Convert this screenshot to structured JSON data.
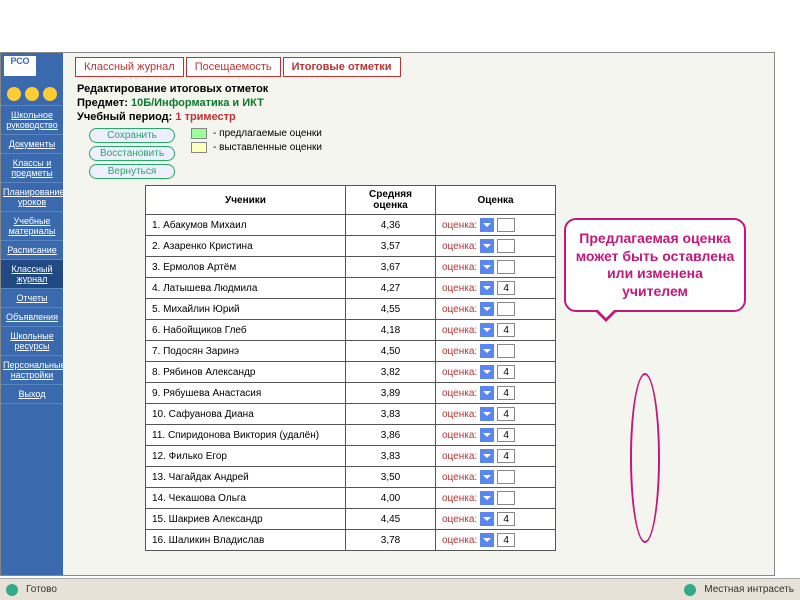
{
  "app": {
    "logo": "РСО"
  },
  "sidebar": {
    "items": [
      {
        "label": "Школьное руководство"
      },
      {
        "label": "Документы"
      },
      {
        "label": "Классы и предметы"
      },
      {
        "label": "Планирование уроков"
      },
      {
        "label": "Учебные материалы"
      },
      {
        "label": "Расписание"
      },
      {
        "label": "Классный журнал",
        "active": true
      },
      {
        "label": "Отчеты"
      },
      {
        "label": "Объявления"
      },
      {
        "label": "Школьные ресурсы"
      },
      {
        "label": "Персональные настройки"
      },
      {
        "label": "Выход"
      }
    ]
  },
  "tabs": [
    {
      "label": "Классный журнал"
    },
    {
      "label": "Посещаемость"
    },
    {
      "label": "Итоговые отметки",
      "active": true
    }
  ],
  "header": {
    "title": "Редактирование итоговых отметок",
    "subject_label": "Предмет:",
    "subject_value": "10Б/Информатика и ИКТ",
    "period_label": "Учебный период:",
    "period_value": "1 триместр"
  },
  "buttons": {
    "save": "Сохранить",
    "restore": "Восстановить",
    "back": "Вернуться"
  },
  "legend": {
    "suggested": "- предлагаемые оценки",
    "entered": "- выставленные оценки"
  },
  "table": {
    "cols": {
      "student": "Ученики",
      "avg": "Средняя оценка",
      "grade": "Оценка"
    },
    "grade_label": "оценка:",
    "rows": [
      {
        "n": "1.",
        "name": "Абакумов Михаил",
        "avg": "4,36",
        "grade": ""
      },
      {
        "n": "2.",
        "name": "Азаренко Кристина",
        "avg": "3,57",
        "grade": ""
      },
      {
        "n": "3.",
        "name": "Ермолов Артём",
        "avg": "3,67",
        "grade": ""
      },
      {
        "n": "4.",
        "name": "Латышева Людмила",
        "avg": "4,27",
        "grade": "4"
      },
      {
        "n": "5.",
        "name": "Михайлин Юрий",
        "avg": "4,55",
        "grade": ""
      },
      {
        "n": "6.",
        "name": "Набойщиков Глеб",
        "avg": "4,18",
        "grade": "4"
      },
      {
        "n": "7.",
        "name": "Подосян Заринэ",
        "avg": "4,50",
        "grade": ""
      },
      {
        "n": "8.",
        "name": "Рябинов Александр",
        "avg": "3,82",
        "grade": "4"
      },
      {
        "n": "9.",
        "name": "Рябушева Анастасия",
        "avg": "3,89",
        "grade": "4"
      },
      {
        "n": "10.",
        "name": "Сафуанова Диана",
        "avg": "3,83",
        "grade": "4"
      },
      {
        "n": "11.",
        "name": "Спиридонова Виктория (удалён)",
        "avg": "3,86",
        "grade": "4"
      },
      {
        "n": "12.",
        "name": "Филько Егор",
        "avg": "3,83",
        "grade": "4"
      },
      {
        "n": "13.",
        "name": "Чагайдак Андрей",
        "avg": "3,50",
        "grade": ""
      },
      {
        "n": "14.",
        "name": "Чекашова Ольга",
        "avg": "4,00",
        "grade": ""
      },
      {
        "n": "15.",
        "name": "Шакриев Александр",
        "avg": "4,45",
        "grade": "4"
      },
      {
        "n": "16.",
        "name": "Шаликин Владислав",
        "avg": "3,78",
        "grade": "4"
      }
    ]
  },
  "callout": {
    "text": "Предлагаемая оценка может быть оставлена или изменена учителем"
  },
  "status": {
    "ready": "Готово",
    "zone": "Местная интрасеть"
  }
}
